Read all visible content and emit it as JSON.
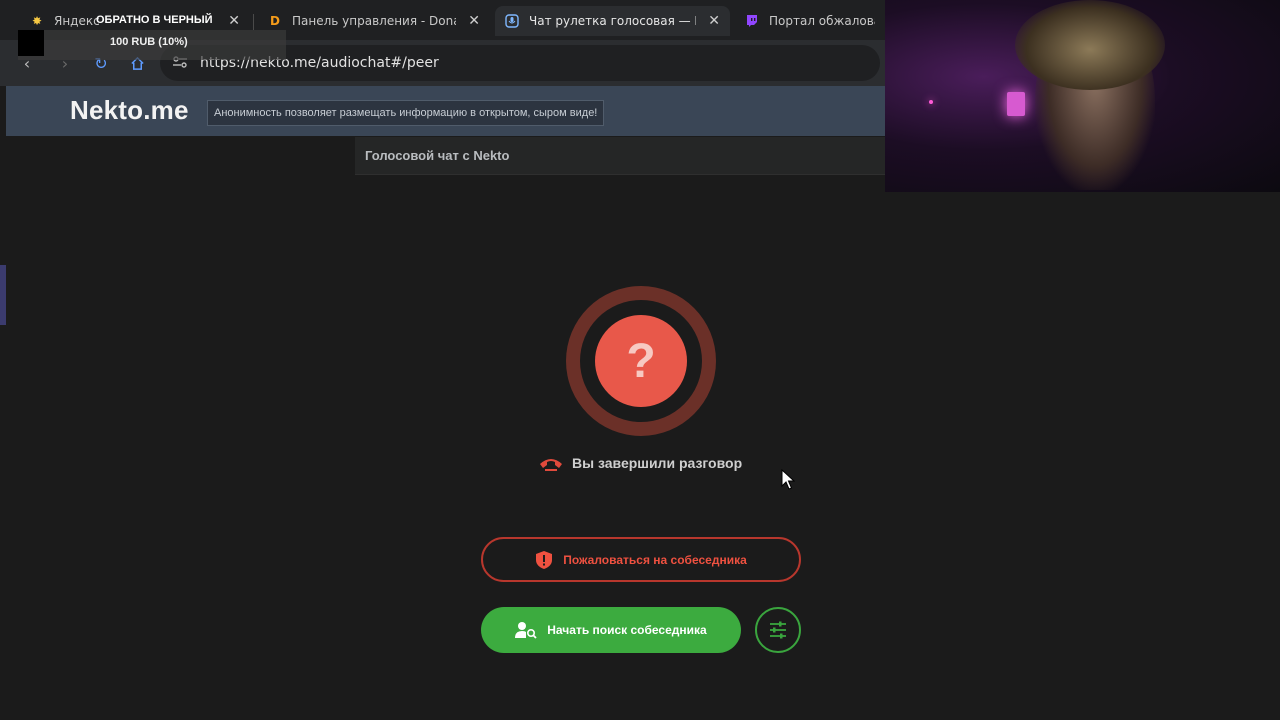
{
  "browser": {
    "tabs": [
      {
        "label": "Яндекс",
        "icon": "yandex-sun-icon",
        "active": false
      },
      {
        "label": "Панель управления - Donation",
        "icon": "donationalerts-icon",
        "active": false
      },
      {
        "label": "Чат рулетка голосовая — Nek",
        "icon": "microphone-icon",
        "active": true
      },
      {
        "label": "Портал обжалования",
        "icon": "twitch-icon",
        "active": false
      }
    ],
    "url": "https://nekto.me/audiochat#/peer"
  },
  "overlay": {
    "top_text": "ОБРАТНО В ЧЕРНЫЙ",
    "donation_text": "100 RUB (10%)"
  },
  "site": {
    "logo": "Nekto.me",
    "motto": "Анонимность позволяет размещать информацию в открытом, сыром виде!",
    "subheader": "Голосовой чат с Nekto"
  },
  "main": {
    "status_symbol": "?",
    "status_text": "Вы завершили разговор",
    "report_button": "Пожаловаться на собеседника",
    "search_button": "Начать поиск собеседника"
  },
  "colors": {
    "accent_red": "#e8584a",
    "accent_green": "#3cab3f",
    "header_bg": "#3a4656"
  }
}
